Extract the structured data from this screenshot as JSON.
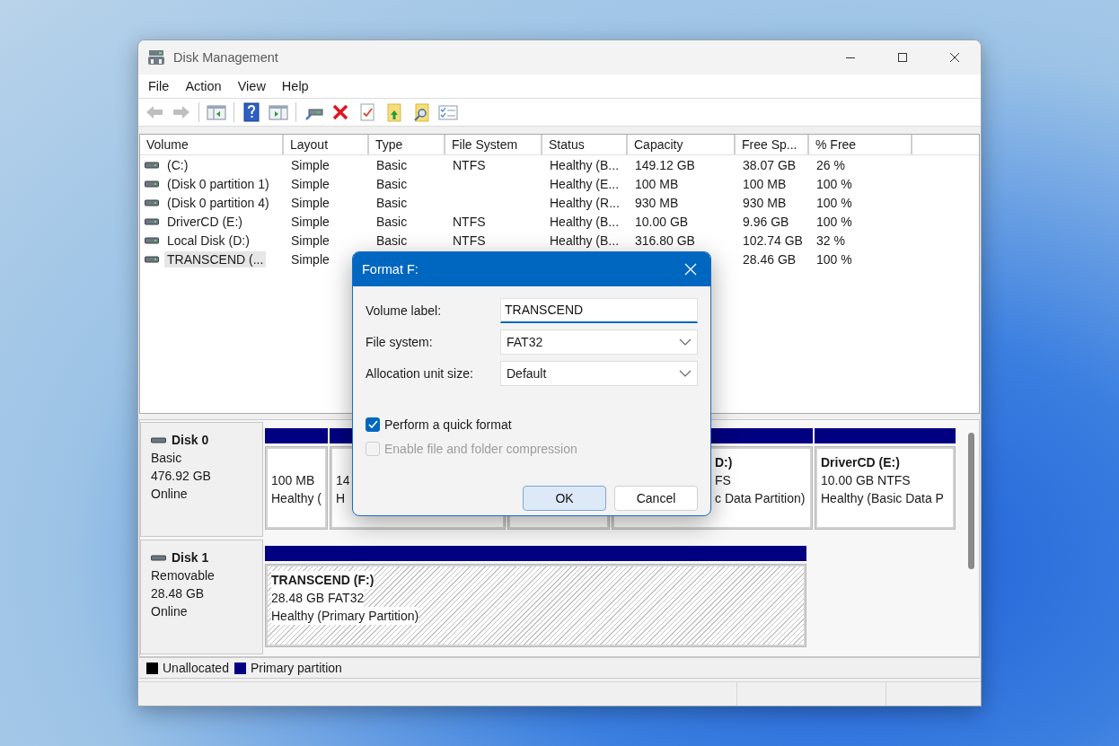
{
  "window": {
    "title": "Disk Management"
  },
  "menu": [
    "File",
    "Action",
    "View",
    "Help"
  ],
  "toolbar": [
    [
      {
        "kind": "back",
        "disabled": true
      },
      {
        "kind": "forward",
        "disabled": true
      }
    ],
    [
      {
        "kind": "tree",
        "disabled": false
      }
    ],
    [
      {
        "kind": "help",
        "disabled": false
      },
      {
        "kind": "pane",
        "disabled": false
      }
    ],
    [
      {
        "kind": "drive",
        "disabled": false
      },
      {
        "kind": "delete",
        "disabled": false
      },
      {
        "kind": "properties",
        "disabled": false
      },
      {
        "kind": "up",
        "disabled": false
      },
      {
        "kind": "search",
        "disabled": false
      },
      {
        "kind": "list",
        "disabled": false
      }
    ]
  ],
  "volume_list": {
    "columns": [
      "Volume",
      "Layout",
      "Type",
      "File System",
      "Status",
      "Capacity",
      "Free Sp...",
      "% Free"
    ],
    "rows": [
      {
        "selected": false,
        "cells": [
          "(C:)",
          "Simple",
          "Basic",
          "NTFS",
          "Healthy (B...",
          "149.12 GB",
          "38.07 GB",
          "26 %"
        ]
      },
      {
        "selected": false,
        "cells": [
          "(Disk 0 partition 1)",
          "Simple",
          "Basic",
          null,
          "Healthy (E...",
          "100 MB",
          "100 MB",
          "100 %"
        ]
      },
      {
        "selected": false,
        "cells": [
          "(Disk 0 partition 4)",
          "Simple",
          "Basic",
          null,
          "Healthy (R...",
          "930 MB",
          "930 MB",
          "100 %"
        ]
      },
      {
        "selected": false,
        "cells": [
          "DriverCD (E:)",
          "Simple",
          "Basic",
          "NTFS",
          "Healthy (B...",
          "10.00 GB",
          "9.96 GB",
          "100 %"
        ]
      },
      {
        "selected": false,
        "cells": [
          "Local Disk (D:)",
          "Simple",
          "Basic",
          "NTFS",
          "Healthy (B...",
          "316.80 GB",
          "102.74 GB",
          "32 %"
        ]
      },
      {
        "selected": true,
        "cells": [
          "TRANSCEND (...",
          "Simple",
          null,
          null,
          null,
          null,
          "28.46 GB",
          "100 %"
        ]
      }
    ]
  },
  "disks": [
    {
      "name": "Disk 0",
      "lines": [
        "Basic",
        "476.92 GB",
        "Online"
      ],
      "partitions": [
        {
          "kind": "visible",
          "selected": false,
          "lines": [
            "100 MB",
            "Healthy ("
          ]
        },
        {
          "kind": "visible",
          "selected": false,
          "lines": [
            "14",
            "H"
          ]
        },
        {
          "kind": "hidden",
          "selected": false
        },
        {
          "kind": "covered",
          "selected": false,
          "title": "D:)",
          "lines": [
            "FS",
            "c Data Partition)"
          ]
        },
        {
          "kind": "visible",
          "selected": false,
          "title": "DriverCD  (E:)",
          "lines": [
            "10.00 GB NTFS",
            "Healthy (Basic Data P"
          ]
        }
      ]
    },
    {
      "name": "Disk 1",
      "lines": [
        "Removable",
        "28.48 GB",
        "Online"
      ],
      "partitions": [
        {
          "kind": "visible",
          "selected": true,
          "title": "TRANSCEND  (F:)",
          "lines": [
            "28.48 GB FAT32",
            "Healthy (Primary Partition)"
          ]
        }
      ]
    }
  ],
  "legend": [
    {
      "label": "Unallocated",
      "color": "#000000"
    },
    {
      "label": "Primary partition",
      "color": "#000080"
    }
  ],
  "dialog": {
    "title": "Format F:",
    "fields": [
      {
        "kind": "text",
        "label": "Volume label:",
        "value": "TRANSCEND"
      },
      {
        "kind": "dropdown",
        "label": "File system:",
        "value": "FAT32"
      },
      {
        "kind": "dropdown",
        "label": "Allocation unit size:",
        "value": "Default"
      }
    ],
    "options": [
      {
        "label": "Perform a quick format",
        "checked": true,
        "disabled": false
      },
      {
        "label": "Enable file and folder compression",
        "checked": false,
        "disabled": true
      }
    ],
    "buttons": [
      {
        "label": "OK",
        "default": true
      },
      {
        "label": "Cancel",
        "default": false
      }
    ]
  }
}
